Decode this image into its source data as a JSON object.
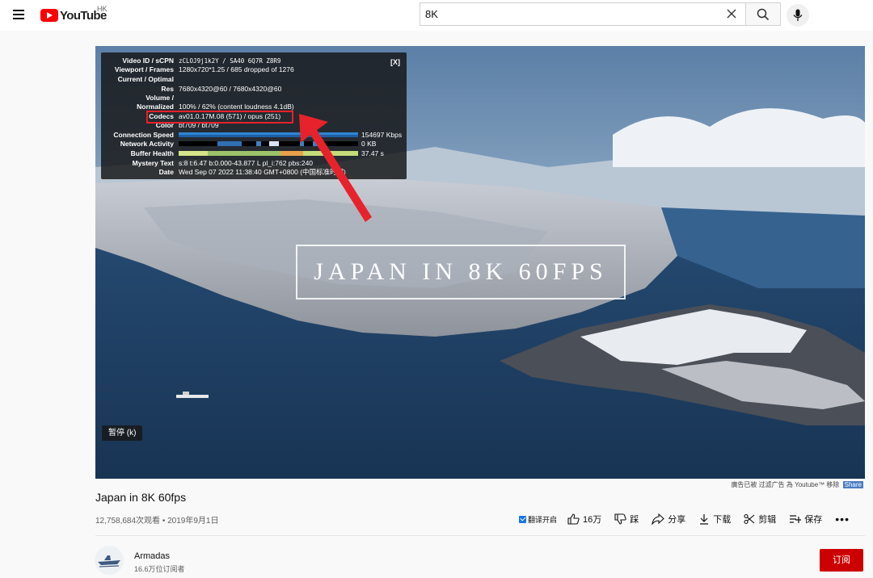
{
  "header": {
    "logo_text": "YouTube",
    "region": "HK",
    "search": {
      "value": "8K",
      "placeholder": ""
    }
  },
  "player": {
    "overlay_title": "JAPAN IN 8K 60FPS",
    "pause_tooltip": "暂停 (k)",
    "stats": {
      "close_label": "[X]",
      "rows": [
        {
          "label": "Video ID / sCPN",
          "value": "zCLOJ9j1k2Y / SA40 6Q7R Z8R9"
        },
        {
          "label": "Viewport / Frames",
          "value": "1280x720*1.25 / 685 dropped of 1276"
        },
        {
          "label": "Current / Optimal",
          "value": ""
        },
        {
          "label": "Res",
          "value": "7680x4320@60 / 7680x4320@60"
        },
        {
          "label": "Volume /",
          "value": ""
        },
        {
          "label": "Normalized",
          "value": "100% / 62% (content loudness 4.1dB)"
        },
        {
          "label": "Codecs",
          "value": "av01.0.17M.08 (571) / opus (251)"
        },
        {
          "label": "Color",
          "value": "bt709 / bt709"
        },
        {
          "label": "Connection Speed",
          "value": "154697 Kbps"
        },
        {
          "label": "Network Activity",
          "value": "0 KB"
        },
        {
          "label": "Buffer Health",
          "value": "37.47 s"
        },
        {
          "label": "Mystery Text",
          "value": "s:8 t:6.47 b:0.000-43.877 L pl_i:762 pbs:240"
        },
        {
          "label": "Date",
          "value": "Wed Sep 07 2022 11:38:40 GMT+0800 (中国标准时间)"
        }
      ]
    }
  },
  "ad_notice": {
    "text": "廣告已被 过滤广告 為 Youtube™ 移除",
    "share_label": "Share"
  },
  "video": {
    "title": "Japan in 8K 60fps",
    "views_date": "12,758,684次观看 • 2019年9月1日"
  },
  "actions": {
    "translate_label": "翻译开启",
    "like_count": "16万",
    "dislike_label": "踩",
    "share_label": "分享",
    "download_label": "下载",
    "clip_label": "剪辑",
    "save_label": "保存",
    "more_label": "•••"
  },
  "channel": {
    "name": "Armadas",
    "subscribers": "16.6万位订阅者",
    "subscribe_label": "订阅"
  },
  "colors": {
    "brand_red": "#ff0000",
    "subscribe_red": "#cc0000",
    "highlight_red": "#e8222b",
    "link_blue": "#1a73e8"
  }
}
